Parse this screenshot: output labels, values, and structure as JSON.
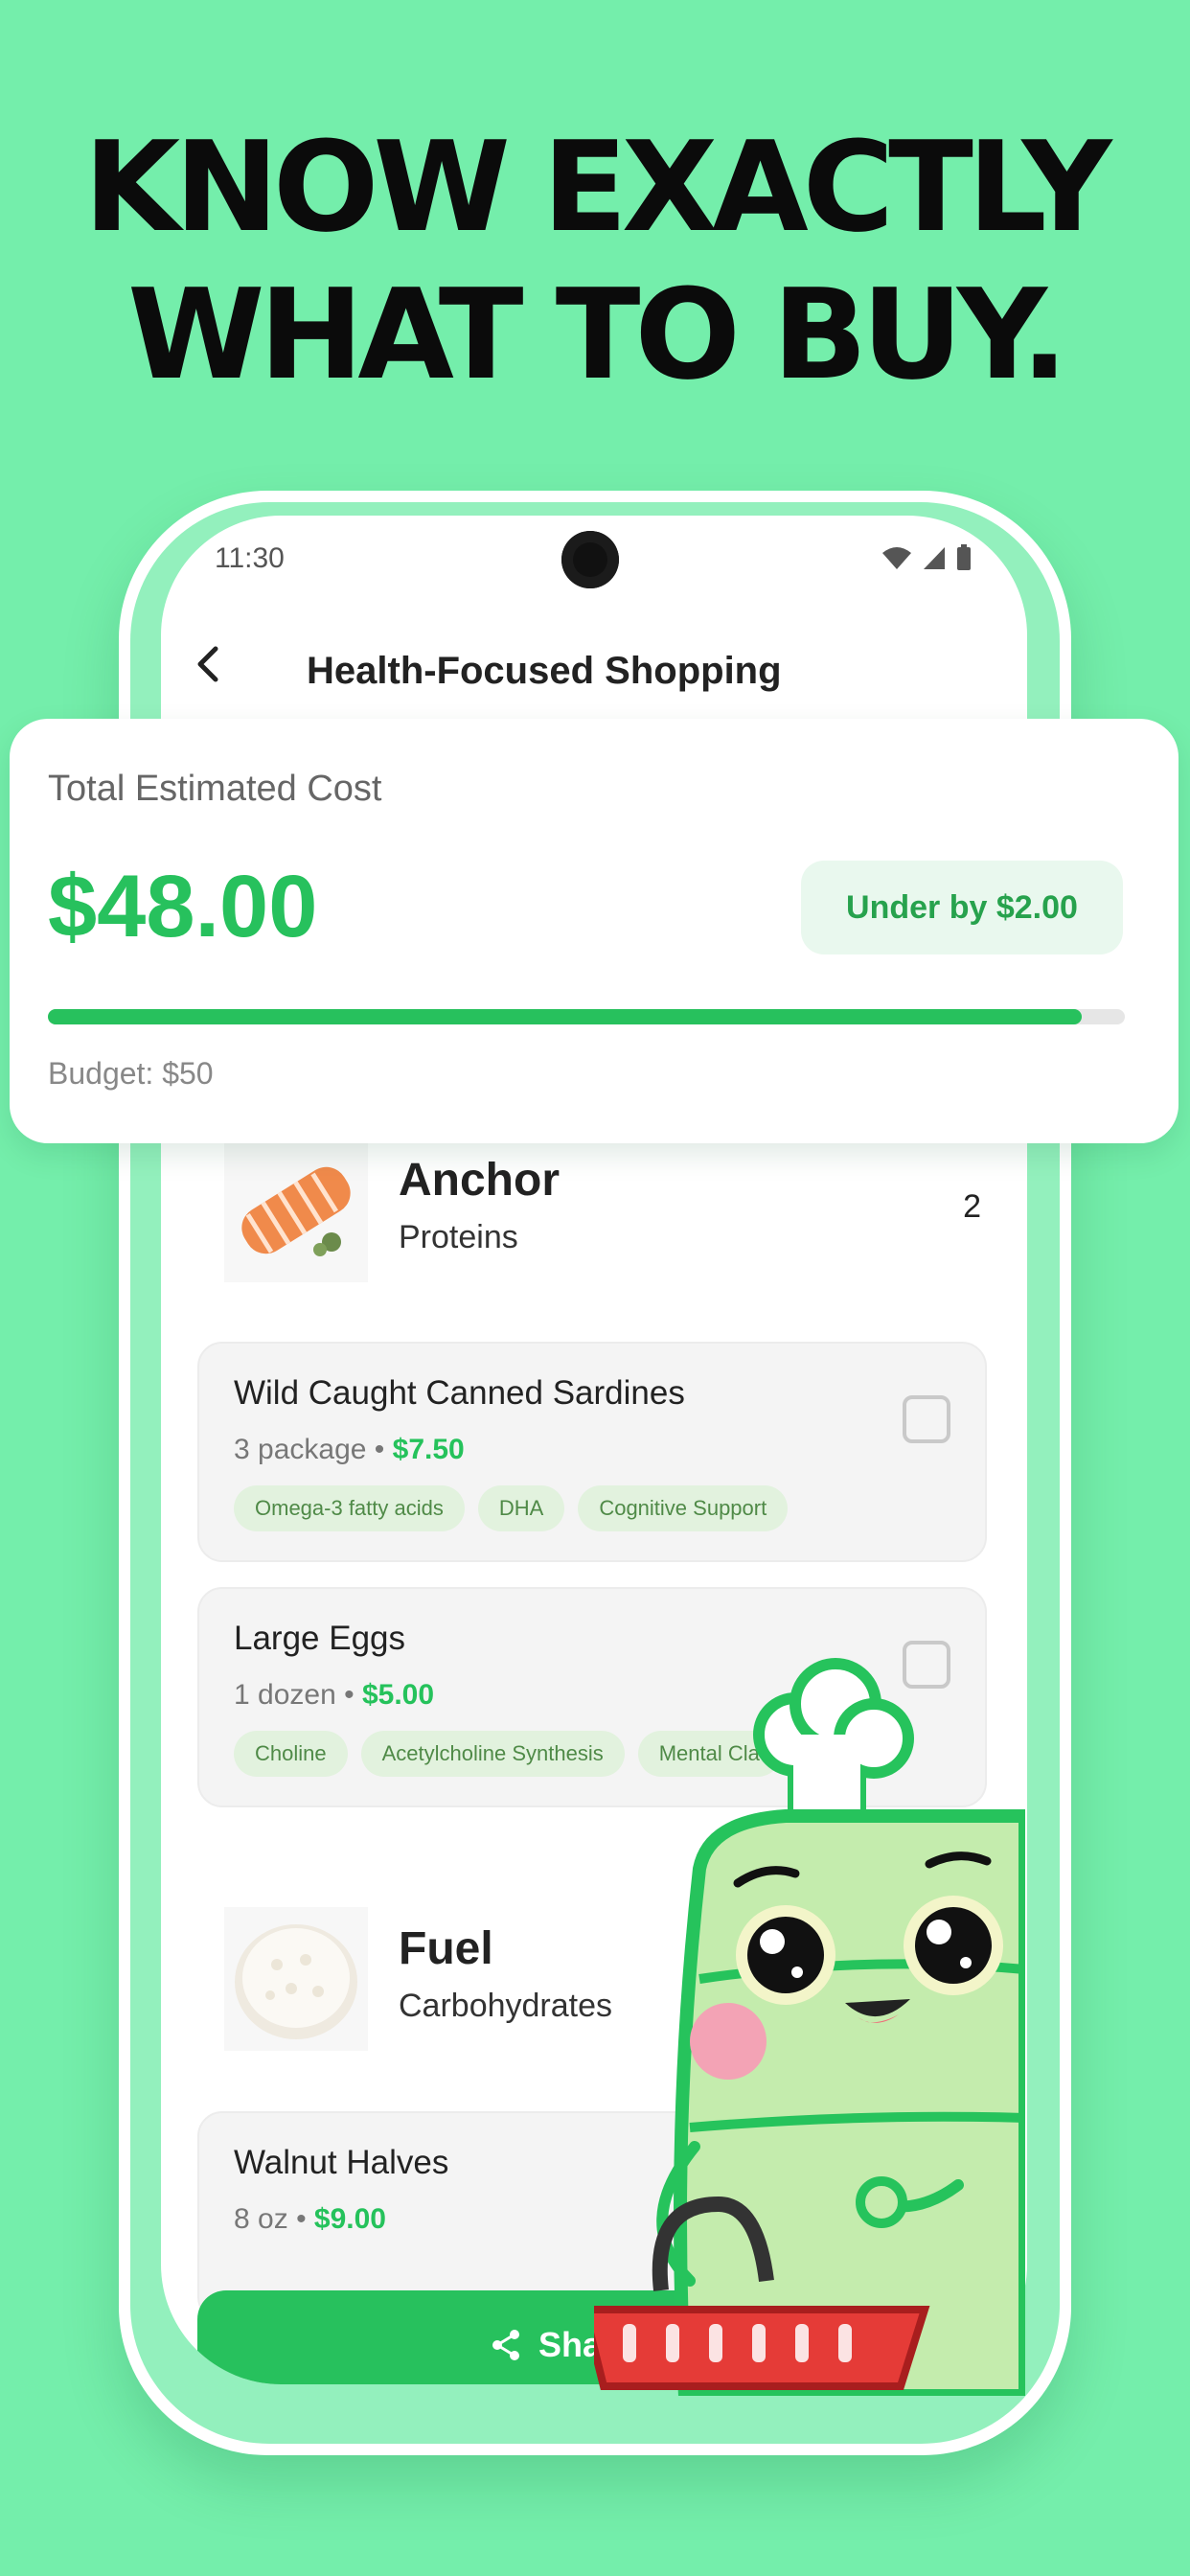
{
  "headline": {
    "line1": "KNOW EXACTLY",
    "line2": "WHAT TO BUY."
  },
  "status_bar": {
    "time": "11:30",
    "icons": [
      "wifi-icon",
      "signal-icon",
      "battery-icon"
    ]
  },
  "nav": {
    "back_icon": "chevron-left-icon",
    "title": "Health-Focused Shopping"
  },
  "summary": {
    "label": "Total Estimated Cost",
    "amount": "$48.00",
    "badge": "Under by $2.00",
    "budget_label": "Budget: $50",
    "progress_fraction": 0.96
  },
  "categories": [
    {
      "name": "Anchor",
      "subtitle": "Proteins",
      "count": "2",
      "thumb_icon": "salmon-icon",
      "items": [
        {
          "name": "Wild Caught Canned Sardines",
          "qty": "3 package",
          "price": "$7.50",
          "tags": [
            "Omega-3 fatty acids",
            "DHA",
            "Cognitive Support"
          ]
        },
        {
          "name": "Large Eggs",
          "qty": "1 dozen",
          "price": "$5.00",
          "tags": [
            "Choline",
            "Acetylcholine Synthesis",
            "Mental Cla"
          ]
        }
      ]
    },
    {
      "name": "Fuel",
      "subtitle": "Carbohydrates",
      "thumb_icon": "rice-icon",
      "items": [
        {
          "name": "Walnut Halves",
          "qty": "8 oz",
          "price": "$9.00"
        }
      ]
    }
  ],
  "separator": "•",
  "share_button": {
    "label": "Sha",
    "icon": "share-icon"
  },
  "colors": {
    "background": "#74eeab",
    "accent": "#27c15d",
    "tag_bg": "#e2f2de",
    "tag_text": "#4f8a47"
  },
  "mascot_icon": "chef-mascot-with-basket-icon"
}
